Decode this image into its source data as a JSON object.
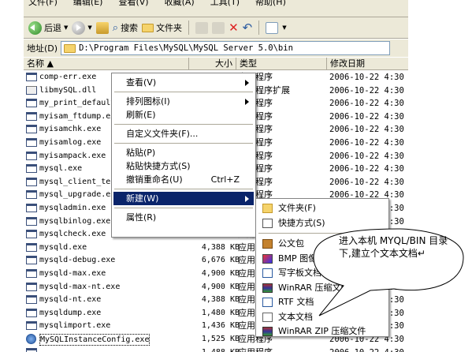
{
  "menubar": [
    "文件(F)",
    "编辑(E)",
    "查看(V)",
    "收藏(A)",
    "工具(T)",
    "帮助(H)"
  ],
  "toolbar": {
    "back": "后退",
    "search": "搜索",
    "folders": "文件夹"
  },
  "address": {
    "label": "地址(D)",
    "value": "D:\\Program Files\\MySQL\\MySQL Server 5.0\\bin"
  },
  "columns": {
    "name": "名称 ▲",
    "size": "大小",
    "type": "类型",
    "modified": "修改日期"
  },
  "files": [
    {
      "name": "comp-err.exe",
      "size": "",
      "type": "应用程序",
      "date": "2006-10-22 4:30",
      "icon": "exe"
    },
    {
      "name": "libmySQL.dll",
      "size": "",
      "type": "应用程序扩展",
      "date": "2006-10-22 4:30",
      "icon": "dll"
    },
    {
      "name": "my_print_defaults.exe",
      "size": "",
      "type": "应用程序",
      "date": "2006-10-22 4:30",
      "icon": "exe"
    },
    {
      "name": "myisam_ftdump.exe",
      "size": "",
      "type": "应用程序",
      "date": "2006-10-22 4:30",
      "icon": "exe"
    },
    {
      "name": "myisamchk.exe",
      "size": "",
      "type": "应用程序",
      "date": "2006-10-22 4:30",
      "icon": "exe"
    },
    {
      "name": "myisamlog.exe",
      "size": "",
      "type": "应用程序",
      "date": "2006-10-22 4:30",
      "icon": "exe"
    },
    {
      "name": "myisampack.exe",
      "size": "",
      "type": "应用程序",
      "date": "2006-10-22 4:30",
      "icon": "exe"
    },
    {
      "name": "mysql.exe",
      "size": "",
      "type": "应用程序",
      "date": "2006-10-22 4:30",
      "icon": "exe"
    },
    {
      "name": "mysql_client_test.exe",
      "size": "",
      "type": "应用程序",
      "date": "2006-10-22 4:30",
      "icon": "exe"
    },
    {
      "name": "mysql_upgrade.exe",
      "size": "",
      "type": "应用程序",
      "date": "2006-10-22 4:30",
      "icon": "exe"
    },
    {
      "name": "mysqladmin.exe",
      "size": "",
      "type": "应用程序",
      "date": "2006-10-22 4:30",
      "icon": "exe"
    },
    {
      "name": "mysqlbinlog.exe",
      "size": "",
      "type": "应用程序",
      "date": "2006-10-22 4:30",
      "icon": "exe"
    },
    {
      "name": "mysqlcheck.exe",
      "size": "",
      "type": "应用程序",
      "date": "2006-10-22 4:30",
      "icon": "exe"
    },
    {
      "name": "mysqld.exe",
      "size": "4,388 KB",
      "type": "应用程序",
      "date": "2006-10-22 4:30",
      "icon": "exe"
    },
    {
      "name": "mysqld-debug.exe",
      "size": "6,676 KB",
      "type": "应用程序",
      "date": "2006-10-22 4:30",
      "icon": "exe"
    },
    {
      "name": "mysqld-max.exe",
      "size": "4,900 KB",
      "type": "应用程序",
      "date": "2006-10-22 4:30",
      "icon": "exe"
    },
    {
      "name": "mysqld-max-nt.exe",
      "size": "4,900 KB",
      "type": "应用程序",
      "date": "2006-10-22 4:30",
      "icon": "exe"
    },
    {
      "name": "mysqld-nt.exe",
      "size": "4,388 KB",
      "type": "应用程序",
      "date": "2006-10-22 4:30",
      "icon": "exe"
    },
    {
      "name": "mysqldump.exe",
      "size": "1,480 KB",
      "type": "应用程序",
      "date": "2006-10-22 4:30",
      "icon": "exe"
    },
    {
      "name": "mysqlimport.exe",
      "size": "1,436 KB",
      "type": "应用程序",
      "date": "2006-10-22 4:30",
      "icon": "exe"
    },
    {
      "name": "MySQLInstanceConfig.exe",
      "size": "1,525 KB",
      "type": "应用程序",
      "date": "2006-10-22 4:30",
      "icon": "cfg"
    },
    {
      "name": "",
      "size": "1,488 KB",
      "type": "应用程序",
      "date": "2006-10-22 4:30",
      "icon": "exe"
    }
  ],
  "context_menu": [
    {
      "label": "查看(V)",
      "shortcut": "",
      "submenu": true
    },
    {
      "separator": true
    },
    {
      "label": "排列图标(I)",
      "shortcut": "",
      "submenu": true
    },
    {
      "label": "刷新(E)",
      "shortcut": "",
      "submenu": false
    },
    {
      "separator": true
    },
    {
      "label": "自定义文件夹(F)...",
      "shortcut": "",
      "submenu": false
    },
    {
      "separator": true
    },
    {
      "label": "粘贴(P)",
      "shortcut": "",
      "submenu": false
    },
    {
      "label": "粘贴快捷方式(S)",
      "shortcut": "",
      "submenu": false
    },
    {
      "label": "撤销重命名(U)",
      "shortcut": "Ctrl+Z",
      "submenu": false
    },
    {
      "separator": true
    },
    {
      "label": "新建(W)",
      "shortcut": "",
      "submenu": true,
      "highlighted": true
    },
    {
      "separator": true
    },
    {
      "label": "属性(R)",
      "shortcut": "",
      "submenu": false
    }
  ],
  "new_submenu": [
    {
      "label": "文件夹(F)",
      "icon": "folder-icon"
    },
    {
      "label": "快捷方式(S)",
      "icon": "shortcut-icon"
    },
    {
      "separator": true
    },
    {
      "label": "公文包",
      "icon": "briefcase-icon"
    },
    {
      "label": "BMP 图像",
      "icon": "bmp-icon"
    },
    {
      "label": "写字板文档",
      "icon": "wordpad-icon"
    },
    {
      "label": "WinRAR 压缩文件",
      "icon": "winrar-icon"
    },
    {
      "label": "RTF 文档",
      "icon": "rtf-icon"
    },
    {
      "label": "文本文档",
      "icon": "text-doc-icon"
    },
    {
      "label": "WinRAR ZIP 压缩文件",
      "icon": "winrar-zip-icon"
    }
  ],
  "callout": {
    "text": "进入本机 MYQL/BIN 目录下,建立个文本文档↵"
  },
  "colors": {
    "menu_highlight": "#0A246A",
    "chrome": "#ECE9D8",
    "border": "#ACA899"
  }
}
